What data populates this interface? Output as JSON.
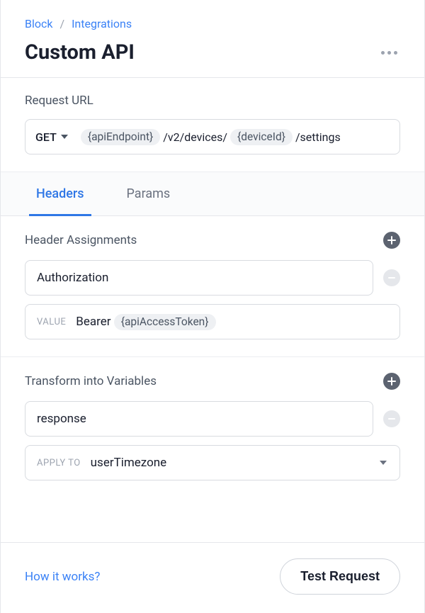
{
  "breadcrumb": {
    "root": "Block",
    "current": "Integrations"
  },
  "title": "Custom API",
  "requestUrl": {
    "label": "Request URL",
    "method": "GET",
    "parts": {
      "var1": "{apiEndpoint}",
      "seg1": "/v2/devices/",
      "var2": "{deviceId}",
      "seg2": "/settings"
    }
  },
  "tabs": {
    "headers": "Headers",
    "params": "Params"
  },
  "headerAssignments": {
    "label": "Header Assignments",
    "key": "Authorization",
    "valueLabel": "VALUE",
    "valuePrefix": "Bearer",
    "valueVar": "{apiAccessToken}"
  },
  "transform": {
    "label": "Transform into Variables",
    "name": "response",
    "applyToLabel": "APPLY TO",
    "applyToValue": "userTimezone"
  },
  "footer": {
    "howItWorks": "How it works?",
    "testRequest": "Test Request"
  }
}
